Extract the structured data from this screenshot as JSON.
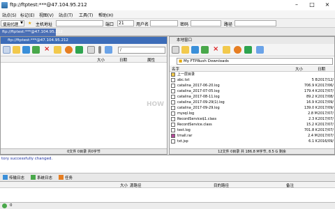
{
  "window": {
    "title": "ftp://ftptest:***@47.104.95.212"
  },
  "menu": {
    "items": [
      "站点(S)",
      "标记(E)",
      "视图(V)",
      "站点(T)",
      "工具(T)",
      "帮助(H)"
    ]
  },
  "address_bar": {
    "quick_connect": "使用代理",
    "host_label": "主机地址",
    "port_label": "端口",
    "port_value": "21",
    "user_label": "用户名",
    "password_label": "密码",
    "path_label": "路径"
  },
  "tabs": {
    "active": "ftp://ftptest:***@47.104.95.212"
  },
  "left_pane": {
    "header": "ftp://ftptest:***@47.104.95.212",
    "path": "/",
    "columns": {
      "size": "大小",
      "date": "日期",
      "attr": "属性"
    },
    "status": "0文件 0目录 共0字节"
  },
  "right_pane": {
    "header": "本地窗口",
    "path": "My FTPRush Downloads",
    "columns": {
      "name": "名字",
      "size": "大小",
      "date": "日期"
    },
    "files": [
      {
        "name": "上一层目录",
        "size": "",
        "date": ""
      },
      {
        "name": "abc.txt",
        "size": "5 B",
        "date": "2017/12/"
      },
      {
        "name": "catalina_2017-06-20.log",
        "size": "706.9 K",
        "date": "2017/06/"
      },
      {
        "name": "catalina_2017-07-05.log",
        "size": "179.4 K",
        "date": "2017/07/"
      },
      {
        "name": "catalina_2017-08-11.log",
        "size": "89.2 K",
        "date": "2017/08/"
      },
      {
        "name": "catalina_2017-09-29(1).log",
        "size": "16.9 K",
        "date": "2017/09/"
      },
      {
        "name": "catalina_2017-09-29.log",
        "size": "139.0 K",
        "date": "2017/09/"
      },
      {
        "name": "mysql.log",
        "size": "2.8 M",
        "date": "2017/07/"
      },
      {
        "name": "RecordService$1.class",
        "size": "2.3 K",
        "date": "2017/07/"
      },
      {
        "name": "RecordService.class",
        "size": "15.2 K",
        "date": "2017/07/"
      },
      {
        "name": "test.log",
        "size": "701.8 K",
        "date": "2017/07/"
      },
      {
        "name": "tmall.rar",
        "size": "2.4 M",
        "date": "2017/07/"
      },
      {
        "name": "txt.jsp",
        "size": "6.1 K",
        "date": "2016/09/"
      }
    ],
    "status": "12文件 0目录 共 186.8 M字节, 8.5 G 剩余"
  },
  "log": {
    "line": "tory successfully changed."
  },
  "bottom_tabs": [
    "传输日志",
    "系统日志",
    "任务"
  ],
  "queue": {
    "columns": {
      "size": "大小",
      "src": "源路径",
      "dest": "目的路径",
      "note": "备注"
    }
  },
  "bottom_status": {
    "count": "0"
  },
  "watermark": "HOW",
  "colors": {
    "accent": "#3c6cb8",
    "log_text": "#1b2fa0",
    "close_red": "#d22222"
  }
}
